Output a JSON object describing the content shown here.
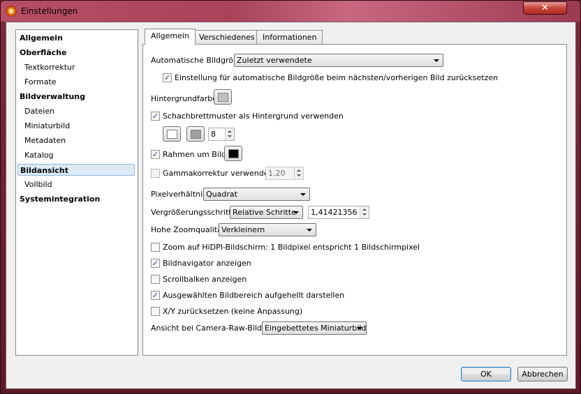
{
  "window": {
    "title": "Einstellungen",
    "close_label": "✕"
  },
  "sidebar": {
    "items": [
      {
        "label": "Allgemein",
        "level": "top"
      },
      {
        "label": "Oberfläche",
        "level": "top"
      },
      {
        "label": "Textkorrektur",
        "level": "sub"
      },
      {
        "label": "Formate",
        "level": "sub"
      },
      {
        "label": "Bildverwaltung",
        "level": "top"
      },
      {
        "label": "Dateien",
        "level": "sub"
      },
      {
        "label": "Miniaturbild",
        "level": "sub"
      },
      {
        "label": "Metadaten",
        "level": "sub"
      },
      {
        "label": "Katalog",
        "level": "sub"
      },
      {
        "label": "Bildansicht",
        "level": "top",
        "selected": true
      },
      {
        "label": "Vollbild",
        "level": "sub"
      },
      {
        "label": "Systemintegration",
        "level": "top"
      }
    ]
  },
  "tabs": [
    {
      "label": "Allgemein",
      "active": true
    },
    {
      "label": "Verschiedenes"
    },
    {
      "label": "Informationen"
    }
  ],
  "settings": {
    "auto_size_label": "Automatische Bildgröße",
    "auto_size_value": "Zuletzt verwendete",
    "reset_auto_size_label": "Einstellung für automatische Bildgröße beim nächsten/vorherigen Bild zurücksetzen",
    "reset_auto_size_checked": true,
    "background_color_label": "Hintergrundfarbe",
    "background_color": "#c0c0c0",
    "checkerboard_label": "Schachbrettmuster als Hintergrund verwenden",
    "checkerboard_checked": true,
    "checker_color_1": "#ffffff",
    "checker_color_2": "#a0a0a0",
    "checker_size": "8",
    "frame_label": "Rahmen um Bild",
    "frame_checked": true,
    "frame_color": "#000000",
    "gamma_label": "Gammakorrektur verwenden",
    "gamma_checked": false,
    "gamma_value": "1,20",
    "pixel_ratio_label": "Pixelverhältnis",
    "pixel_ratio_value": "Quadrat",
    "zoom_steps_label": "Vergrößerungsschritte",
    "zoom_steps_value": "Relative Schritte",
    "zoom_steps_factor": "1,41421356",
    "zoom_quality_label": "Hohe Zoomqualität",
    "zoom_quality_value": "Verkleinern",
    "hidpi_label": "Zoom auf HiDPI-Bildschirm: 1 Bildpixel entspricht 1 Bildschirmpixel",
    "hidpi_checked": false,
    "navigator_label": "Bildnavigator anzeigen",
    "navigator_checked": true,
    "scrollbars_label": "Scrollbalken anzeigen",
    "scrollbars_checked": false,
    "highlight_label": "Ausgewählten Bildbereich aufgehellt darstellen",
    "highlight_checked": true,
    "reset_xy_label": "X/Y zurücksetzen (keine Anpassung)",
    "reset_xy_checked": false,
    "camera_raw_label": "Ansicht bei Camera-Raw-Bildern",
    "camera_raw_value": "Eingebettetes Miniaturbild"
  },
  "buttons": {
    "ok": "OK",
    "cancel": "Abbrechen"
  },
  "colors": {
    "selection_bg": "#dceaf8",
    "title_accent": "#b84e66",
    "close_red": "#c8443a"
  }
}
